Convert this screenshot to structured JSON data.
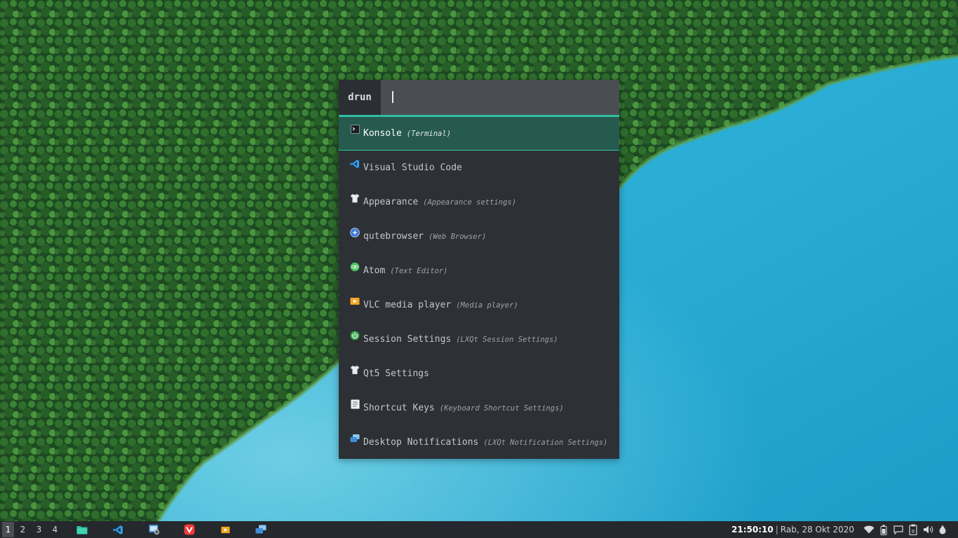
{
  "launcher": {
    "mode": "drun",
    "query": "",
    "entries": [
      {
        "name": "Konsole",
        "desc": "(Terminal)",
        "icon": "terminal-icon",
        "selected": true
      },
      {
        "name": "Visual Studio Code",
        "desc": "",
        "icon": "vscode-icon"
      },
      {
        "name": "Appearance",
        "desc": "(Appearance settings)",
        "icon": "shirt-icon"
      },
      {
        "name": "qutebrowser",
        "desc": "(Web Browser)",
        "icon": "qutebrowser-icon"
      },
      {
        "name": "Atom",
        "desc": "(Text Editor)",
        "icon": "atom-icon"
      },
      {
        "name": "VLC media player",
        "desc": "(Media player)",
        "icon": "media-player-icon"
      },
      {
        "name": "Session Settings",
        "desc": "(LXQt Session Settings)",
        "icon": "power-icon"
      },
      {
        "name": "Qt5 Settings",
        "desc": "",
        "icon": "shirt-icon"
      },
      {
        "name": "Shortcut Keys",
        "desc": "(Keyboard Shortcut Settings)",
        "icon": "keyboard-icon"
      },
      {
        "name": "Desktop Notifications",
        "desc": "(LXQt Notification Settings)",
        "icon": "notification-icon"
      }
    ]
  },
  "taskbar": {
    "workspaces": [
      "1",
      "2",
      "3",
      "4"
    ],
    "active_workspace": "1",
    "apps": [
      "file-manager-icon",
      "vscode-icon",
      "settings-manager-icon",
      "vivaldi-icon",
      "media-player-icon",
      "remote-desktop-icon"
    ],
    "clock": "21:50:10",
    "separator": "|",
    "date": "Rab, 28 Okt 2020",
    "tray": [
      "wifi-icon",
      "battery-icon",
      "chat-icon",
      "clipboard-icon",
      "volume-icon",
      "dropper-icon"
    ]
  },
  "colors": {
    "accent": "#2fbf9f",
    "selected_bg": "#275a4f",
    "launcher_bg": "#2d3035",
    "input_bg": "#4a4d51",
    "taskbar_bg": "#25282c"
  }
}
